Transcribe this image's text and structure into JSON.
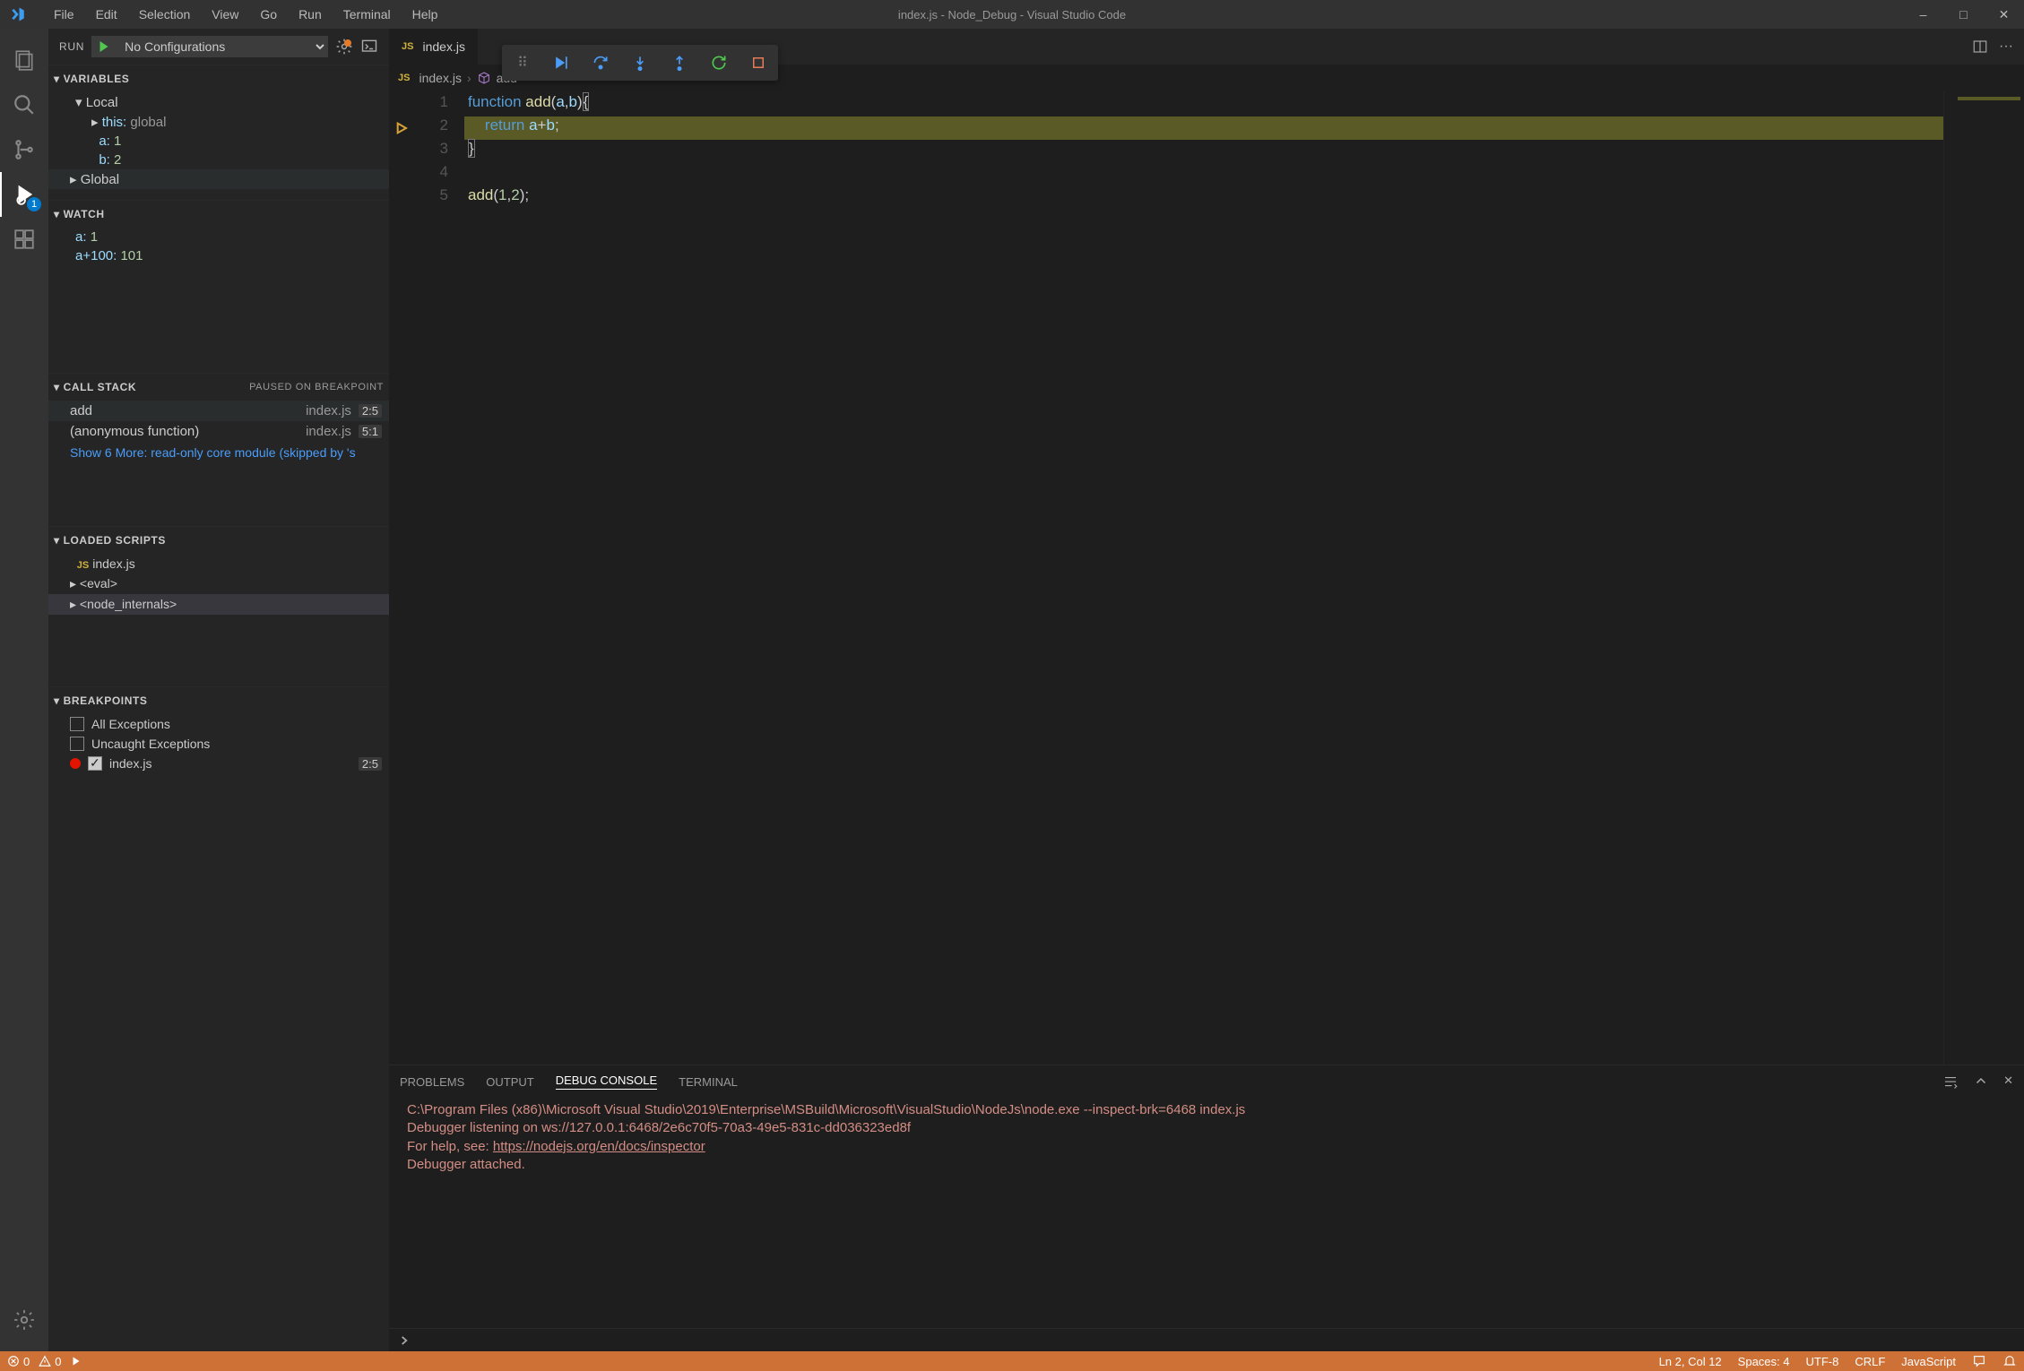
{
  "title": "index.js - Node_Debug - Visual Studio Code",
  "menu": [
    "File",
    "Edit",
    "Selection",
    "View",
    "Go",
    "Run",
    "Terminal",
    "Help"
  ],
  "activitybar": {
    "debug_badge": "1"
  },
  "run": {
    "label": "RUN",
    "config": "No Configurations"
  },
  "variables": {
    "title": "VARIABLES",
    "groups": [
      {
        "name": "Local",
        "expanded": true,
        "items": [
          {
            "k": "this:",
            "v": "global",
            "style": "this"
          },
          {
            "k": "a:",
            "v": "1"
          },
          {
            "k": "b:",
            "v": "2"
          }
        ]
      },
      {
        "name": "Global",
        "expanded": false,
        "items": []
      }
    ]
  },
  "watch": {
    "title": "WATCH",
    "items": [
      {
        "k": "a:",
        "v": "1"
      },
      {
        "k": "a+100:",
        "v": "101"
      }
    ]
  },
  "callstack": {
    "title": "CALL STACK",
    "status": "PAUSED ON BREAKPOINT",
    "frames": [
      {
        "name": "add",
        "file": "index.js",
        "loc": "2:5",
        "sel": true
      },
      {
        "name": "(anonymous function)",
        "file": "index.js",
        "loc": "5:1"
      }
    ],
    "more": "Show 6 More: read-only core module (skipped by 's"
  },
  "loaded": {
    "title": "LOADED SCRIPTS",
    "items": [
      {
        "label": "index.js",
        "icon": "js",
        "expandable": false
      },
      {
        "label": "<eval>",
        "expandable": true
      },
      {
        "label": "<node_internals>",
        "expandable": true,
        "sel": true
      }
    ]
  },
  "breakpoints": {
    "title": "BREAKPOINTS",
    "items": [
      {
        "label": "All Exceptions",
        "checked": false
      },
      {
        "label": "Uncaught Exceptions",
        "checked": false
      },
      {
        "label": "index.js",
        "checked": true,
        "dot": true,
        "loc": "2:5"
      }
    ]
  },
  "tab": {
    "file": "index.js"
  },
  "breadcrumb": {
    "file": "index.js",
    "symbol": "add"
  },
  "code": {
    "lines": [
      1,
      2,
      3,
      4,
      5
    ]
  },
  "panel": {
    "tabs": [
      "PROBLEMS",
      "OUTPUT",
      "DEBUG CONSOLE",
      "TERMINAL"
    ],
    "active": "DEBUG CONSOLE",
    "line1": "C:\\Program Files (x86)\\Microsoft Visual Studio\\2019\\Enterprise\\MSBuild\\Microsoft\\VisualStudio\\NodeJs\\node.exe --inspect-brk=6468 index.js",
    "line2": "Debugger listening on ws://127.0.0.1:6468/2e6c70f5-70a3-49e5-831c-dd036323ed8f",
    "line3_pre": "For help, see: ",
    "line3_link": "https://nodejs.org/en/docs/inspector",
    "line4": "Debugger attached."
  },
  "status": {
    "errors": "0",
    "warnings": "0",
    "pos": "Ln 2, Col 12",
    "spaces": "Spaces: 4",
    "enc": "UTF-8",
    "eol": "CRLF",
    "lang": "JavaScript"
  }
}
